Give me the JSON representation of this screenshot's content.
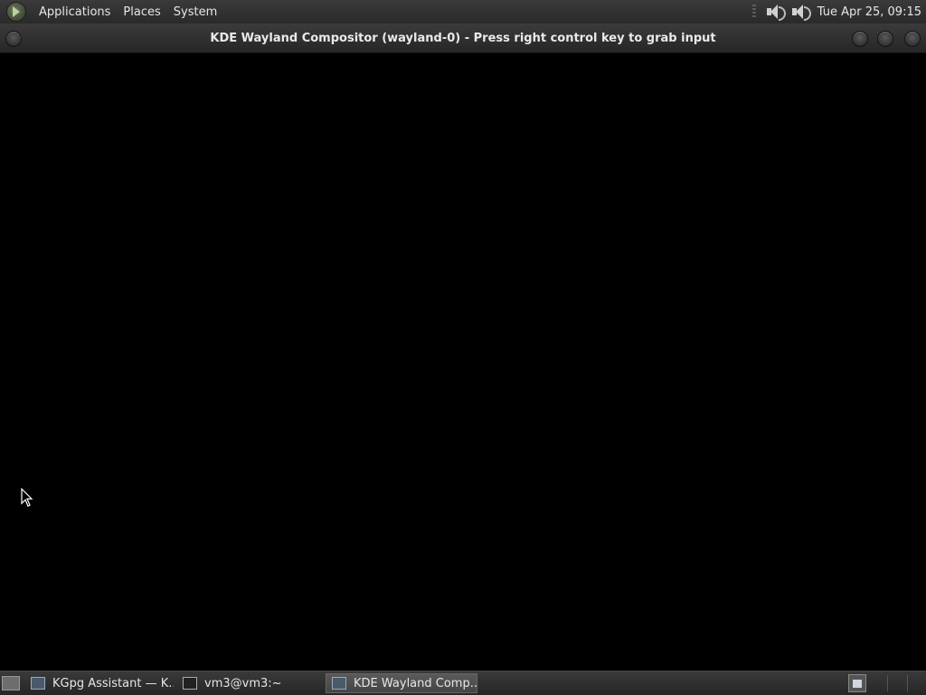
{
  "top_panel": {
    "menu": {
      "applications": "Applications",
      "places": "Places",
      "system": "System"
    },
    "clock": "Tue Apr 25, 09:15"
  },
  "window": {
    "title": "KDE Wayland Compositor (wayland-0) - Press right control key to grab input"
  },
  "taskbar": {
    "tasks": [
      {
        "label": "KGpg Assistant — K...",
        "icon": "window-icon"
      },
      {
        "label": "vm3@vm3:~",
        "icon": "terminal-icon"
      },
      {
        "label": "KDE Wayland Comp...",
        "icon": "window-icon",
        "active": true
      }
    ]
  },
  "colors": {
    "panel_bg": "#2f2f2f",
    "client_bg": "#000000",
    "text": "#e6e6e6"
  }
}
